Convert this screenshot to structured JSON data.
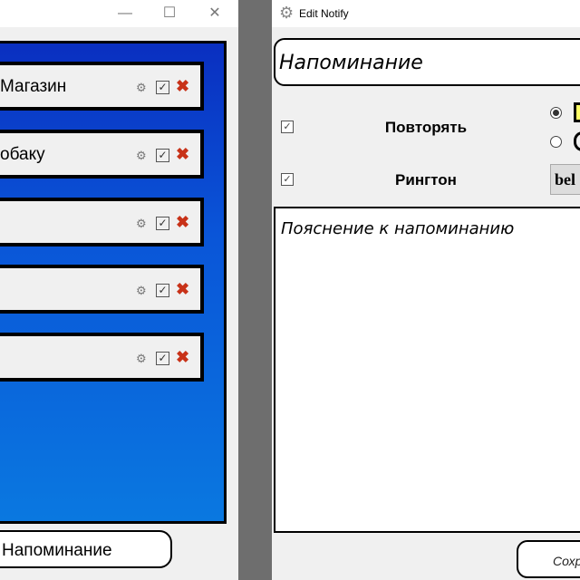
{
  "left_window": {
    "controls": {
      "minimize": "—",
      "maximize": "☐",
      "close": "✕"
    },
    "items": [
      {
        "title": "Магазин"
      },
      {
        "title": "обаку"
      },
      {
        "title": ""
      },
      {
        "title": ""
      },
      {
        "title": ""
      }
    ],
    "add_button": "Напоминание"
  },
  "edit_window": {
    "title": "Edit Notify",
    "name_value": "Напоминание",
    "repeat_label": "Повторять",
    "repeat_checked": true,
    "ringtone_label": "Рингтон",
    "ringtone_checked": true,
    "ringtone_value": "bel",
    "description_placeholder": "Пояснение к напоминанию",
    "save_button": "Сохр"
  },
  "colors": {
    "delete": "#c83218",
    "panel_blue": "#0a55d8"
  }
}
